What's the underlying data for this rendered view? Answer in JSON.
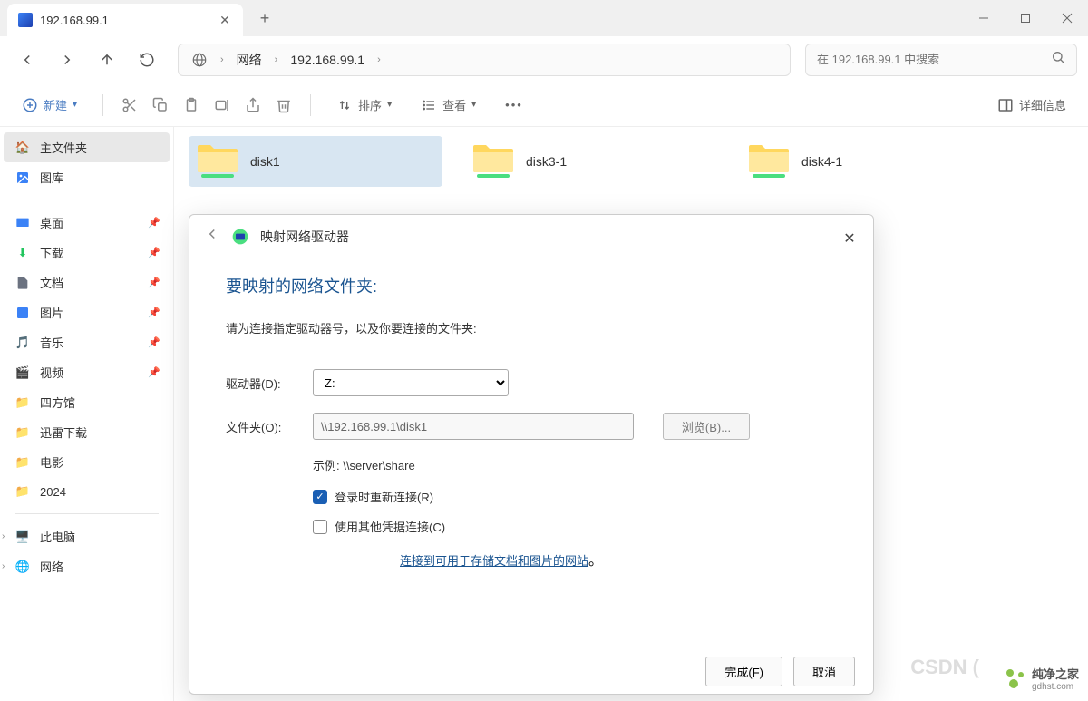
{
  "tab": {
    "title": "192.168.99.1"
  },
  "breadcrumb": {
    "seg1": "网络",
    "seg2": "192.168.99.1"
  },
  "search": {
    "placeholder": "在 192.168.99.1 中搜索"
  },
  "toolbar": {
    "new": "新建",
    "sort": "排序",
    "view": "查看",
    "details": "详细信息"
  },
  "sidebar": {
    "home": "主文件夹",
    "gallery": "图库",
    "desktop": "桌面",
    "downloads": "下载",
    "documents": "文档",
    "pictures": "图片",
    "music": "音乐",
    "videos": "视频",
    "sifangguan": "四方馆",
    "xunlei": "迅雷下载",
    "movies": "电影",
    "y2024": "2024",
    "thispc": "此电脑",
    "network": "网络"
  },
  "folders": [
    {
      "name": "disk1"
    },
    {
      "name": "disk3-1"
    },
    {
      "name": "disk4-1"
    }
  ],
  "dialog": {
    "title": "映射网络驱动器",
    "heading": "要映射的网络文件夹:",
    "desc": "请为连接指定驱动器号，以及你要连接的文件夹:",
    "drive_label": "驱动器(D):",
    "drive_value": "Z:",
    "folder_label": "文件夹(O):",
    "folder_value": "\\\\192.168.99.1\\disk1",
    "browse": "浏览(B)...",
    "example": "示例: \\\\server\\share",
    "reconnect": "登录时重新连接(R)",
    "othercred": "使用其他凭据连接(C)",
    "link": "连接到可用于存储文档和图片的网站",
    "link_suffix": "。",
    "finish": "完成(F)",
    "cancel": "取消"
  },
  "watermark": {
    "csdn": "CSDN (",
    "brand": "纯净之家",
    "site": "gdhst.com"
  }
}
